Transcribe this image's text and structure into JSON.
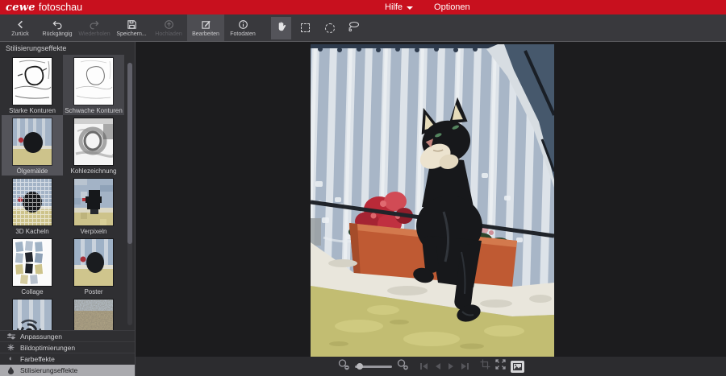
{
  "header": {
    "brand": "cewe",
    "app": "fotoschau",
    "menu": {
      "hilfe": "Hilfe",
      "optionen": "Optionen",
      "hilfe_caret_icon": "chevron-down-icon"
    }
  },
  "toolbar": {
    "buttons": [
      {
        "label": "Zurück",
        "icon": "chevron-left-icon",
        "state": "enabled"
      },
      {
        "label": "Rückgängig",
        "icon": "undo-arrow-icon",
        "state": "enabled"
      },
      {
        "label": "Wiederholen",
        "icon": "redo-arrow-icon",
        "state": "disabled"
      },
      {
        "label": "Speichern...",
        "icon": "save-disk-icon",
        "state": "enabled"
      },
      {
        "label": "Hochladen",
        "icon": "upload-circle-icon",
        "state": "disabled"
      },
      {
        "label": "Bearbeiten",
        "icon": "edit-square-icon",
        "state": "active"
      },
      {
        "label": "Fotodaten",
        "icon": "info-circle-icon",
        "state": "enabled"
      }
    ],
    "tools": [
      {
        "icon": "hand-tool-icon",
        "state": "active"
      },
      {
        "icon": "rect-select-icon",
        "state": "enabled"
      },
      {
        "icon": "ellipse-select-icon",
        "state": "enabled"
      },
      {
        "icon": "lasso-select-icon",
        "state": "enabled"
      }
    ]
  },
  "sidebar": {
    "panel_title": "Stilisierungseffekte",
    "effects": [
      {
        "label": "Starke Konturen",
        "state": "normal"
      },
      {
        "label": "Schwache Konturen",
        "state": "hover"
      },
      {
        "label": "Ölgemälde",
        "state": "selected"
      },
      {
        "label": "Kohlezeichnung",
        "state": "normal"
      },
      {
        "label": "3D Kacheln",
        "state": "normal"
      },
      {
        "label": "Verpixeln",
        "state": "normal"
      },
      {
        "label": "Collage",
        "state": "normal"
      },
      {
        "label": "Poster",
        "state": "normal"
      }
    ],
    "partial_effect_icons": [
      "swirl-effect-icon",
      "grain-effect-icon"
    ],
    "sections": [
      {
        "label": "Anpassungen",
        "icon": "sliders-icon",
        "state": "collapsed"
      },
      {
        "label": "Bildoptimierungen",
        "icon": "sparkle-icon",
        "state": "collapsed"
      },
      {
        "label": "Farbeffekte",
        "icon": "contrast-icon",
        "state": "collapsed"
      },
      {
        "label": "Stilisierungseffekte",
        "icon": "stylize-icon",
        "state": "active"
      }
    ]
  },
  "canvas": {
    "image_description": "Oil-painting stylized photo: black cat figurine hanging from a terracotta flower box with red geraniums, striped white-blue curtain behind, yellow-green wall below"
  },
  "statusbar": {
    "controls": [
      {
        "icon": "zoom-out-icon",
        "state": "enabled"
      },
      {
        "icon": "zoom-slider",
        "state": "enabled"
      },
      {
        "icon": "zoom-in-icon",
        "state": "enabled"
      },
      {
        "icon": "nav-first-icon",
        "state": "disabled"
      },
      {
        "icon": "nav-previous-icon",
        "state": "disabled"
      },
      {
        "icon": "nav-next-icon",
        "state": "disabled"
      },
      {
        "icon": "nav-last-icon",
        "state": "disabled"
      },
      {
        "icon": "crop-frame-icon",
        "state": "disabled"
      },
      {
        "icon": "fit-to-screen-icon",
        "state": "enabled"
      },
      {
        "icon": "show-original-icon",
        "state": "active"
      }
    ]
  },
  "colors": {
    "brand_red": "#c8101e",
    "toolbar_bg": "#39393d",
    "sidebar_bg": "#2f2f32",
    "canvas_bg": "#1c1c1e",
    "statusbar_bg": "#2c2c2f",
    "highlight": "#54545a",
    "section_active_bg": "#aaaaae",
    "text_light": "#cfcfd2",
    "text_disabled": "#5f5f64"
  }
}
